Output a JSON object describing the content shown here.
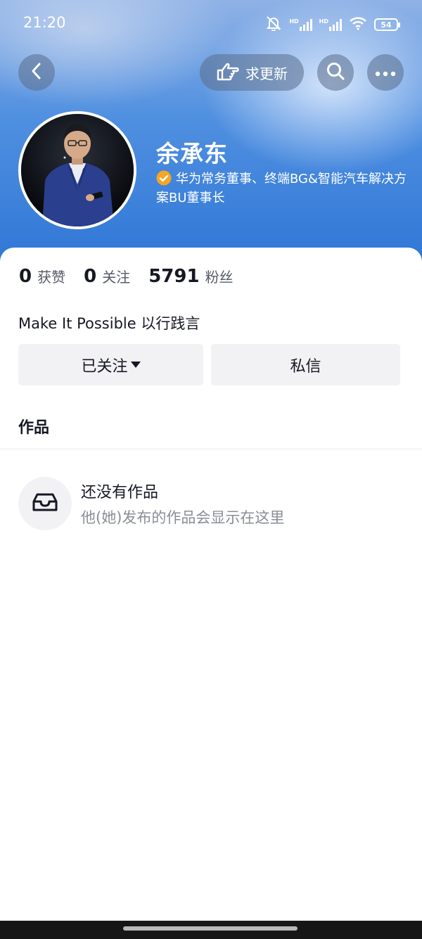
{
  "status_bar": {
    "time": "21:20",
    "battery": "54",
    "hd_label": "HD"
  },
  "top_nav": {
    "request_update_label": "求更新"
  },
  "profile": {
    "name": "余承东",
    "title": "华为常务董事、终端BG&智能汽车解决方案BU董事长"
  },
  "stats": [
    {
      "value": "0",
      "label": "获赞"
    },
    {
      "value": "0",
      "label": "关注"
    },
    {
      "value": "5791",
      "label": "粉丝"
    }
  ],
  "bio": "Make It Possible 以行践言",
  "actions": {
    "follow_label": "已关注",
    "message_label": "私信"
  },
  "tabs": {
    "works": "作品"
  },
  "empty_state": {
    "title": "还没有作品",
    "description": "他(她)发布的作品会显示在这里"
  },
  "colors": {
    "accent_verified": "#f5a623",
    "header_blue": "#2f77d6",
    "text_primary": "#161823",
    "text_secondary": "#8a8d96",
    "button_bg": "#f2f2f4"
  },
  "icons": {
    "back": "chevron-left-icon",
    "request_update": "pointing-hand-icon",
    "search": "search-icon",
    "more": "more-icon",
    "verified": "verified-badge-icon",
    "empty": "inbox-icon"
  }
}
